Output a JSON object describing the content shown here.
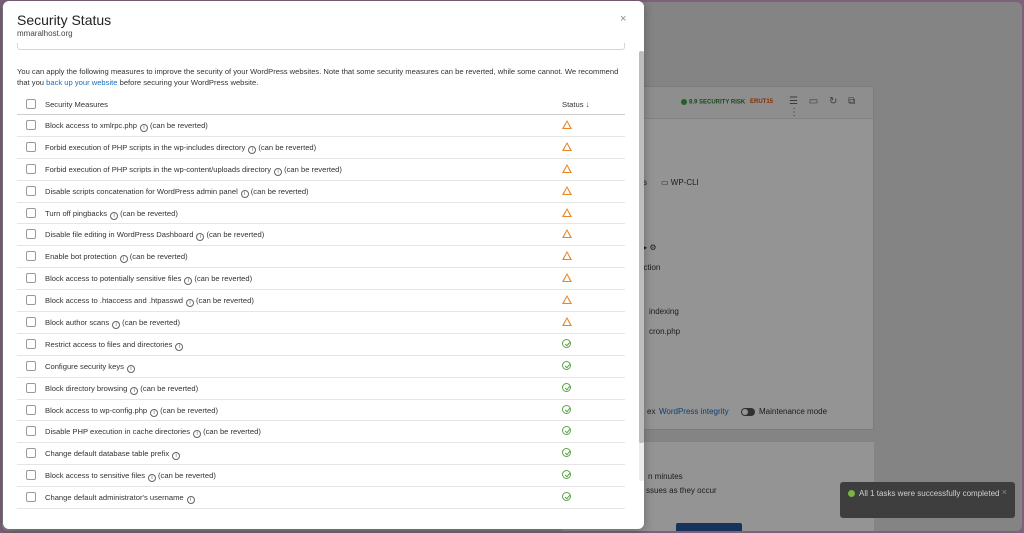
{
  "modal": {
    "title": "Security Status",
    "site": "mmaralhost.org",
    "close_glyph": "×",
    "intro_before": "You can apply the following measures to improve the security of your WordPress websites. Note that some security measures can be reverted, while some cannot. We recommend that you ",
    "intro_link": "back up your website",
    "intro_after": " before securing your WordPress website."
  },
  "table": {
    "col_measures": "Security Measures",
    "col_status": "Status ↓",
    "rows": [
      {
        "name": "Block access to xmlrpc.php",
        "note": "(can be reverted)",
        "status": "warning"
      },
      {
        "name": "Forbid execution of PHP scripts in the wp-includes directory",
        "note": "(can be reverted)",
        "status": "warning"
      },
      {
        "name": "Forbid execution of PHP scripts in the wp-content/uploads directory",
        "note": "(can be reverted)",
        "status": "warning"
      },
      {
        "name": "Disable scripts concatenation for WordPress admin panel",
        "note": "(can be reverted)",
        "status": "warning"
      },
      {
        "name": "Turn off pingbacks",
        "note": "(can be reverted)",
        "status": "warning"
      },
      {
        "name": "Disable file editing in WordPress Dashboard",
        "note": "(can be reverted)",
        "status": "warning"
      },
      {
        "name": "Enable bot protection",
        "note": "(can be reverted)",
        "status": "warning"
      },
      {
        "name": "Block access to potentially sensitive files",
        "note": "(can be reverted)",
        "status": "warning"
      },
      {
        "name": "Block access to .htaccess and .htpasswd",
        "note": "(can be reverted)",
        "status": "warning"
      },
      {
        "name": "Block author scans",
        "note": "(can be reverted)",
        "status": "warning"
      },
      {
        "name": "Restrict access to files and directories",
        "note": "",
        "status": "ok"
      },
      {
        "name": "Configure security keys",
        "note": "",
        "status": "ok"
      },
      {
        "name": "Block directory browsing",
        "note": "(can be reverted)",
        "status": "ok"
      },
      {
        "name": "Block access to wp-config.php",
        "note": "(can be reverted)",
        "status": "ok"
      },
      {
        "name": "Disable PHP execution in cache directories",
        "note": "(can be reverted)",
        "status": "ok"
      },
      {
        "name": "Change default database table prefix",
        "note": "",
        "status": "ok"
      },
      {
        "name": "Block access to sensitive files",
        "note": "(can be reverted)",
        "status": "ok"
      },
      {
        "name": "Change default administrator's username",
        "note": "",
        "status": "ok"
      }
    ]
  },
  "background": {
    "risk_badge": "8.9 SECURITY RISK",
    "orange_badge": "ERUT15",
    "icons": "☰ ▭ ↻ ⧉ ⋮",
    "partial_s": "s",
    "wpcli": "WP-CLI",
    "partial_ection": "ection",
    "partial_indexing": "indexing",
    "partial_cron": "cron.php",
    "partial_ex": "ex",
    "wp_integrity": "WordPress integrity",
    "maintenance_mode": "Maintenance mode",
    "partial_minutes": "n minutes",
    "partial_occur": "ssues as they occur"
  },
  "toast": {
    "message": "All 1 tasks were successfully completed",
    "close_glyph": "×"
  }
}
